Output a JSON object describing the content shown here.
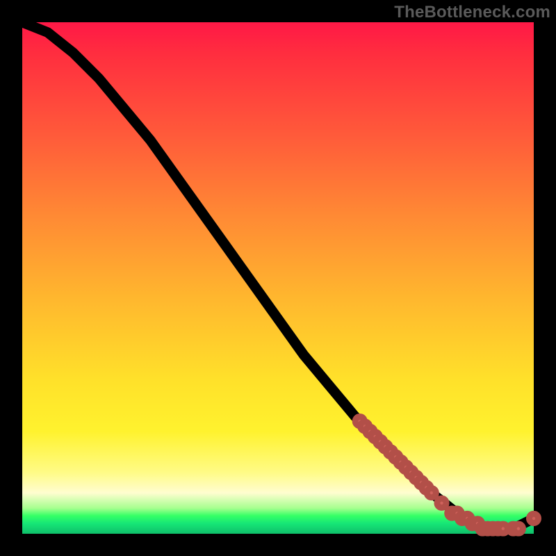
{
  "watermark": "TheBottleneck.com",
  "colors": {
    "marker_fill": "#cf625b",
    "marker_stroke": "#b24f48",
    "line": "#000000",
    "bg": "#000000"
  },
  "chart_data": {
    "type": "line",
    "title": "",
    "xlabel": "",
    "ylabel": "",
    "xlim": [
      0,
      100
    ],
    "ylim": [
      0,
      100
    ],
    "grid": false,
    "legend": false,
    "series": [
      {
        "name": "curve",
        "x": [
          0,
          5,
          10,
          15,
          20,
          25,
          30,
          35,
          40,
          45,
          50,
          55,
          60,
          65,
          70,
          75,
          80,
          85,
          88,
          92,
          96,
          100
        ],
        "y": [
          100,
          98,
          94,
          89,
          83,
          77,
          70,
          63,
          56,
          49,
          42,
          35,
          29,
          23,
          18,
          13,
          8,
          4,
          2,
          1,
          1,
          3
        ]
      }
    ],
    "markers": {
      "name": "highlight-points",
      "x": [
        66,
        67,
        68,
        69,
        70,
        71,
        72,
        73,
        74,
        75,
        76,
        77,
        78,
        79,
        80,
        82,
        84,
        85,
        86,
        87,
        88,
        89,
        90,
        91,
        92,
        93,
        94,
        96,
        97,
        100
      ],
      "y": [
        22,
        21,
        20,
        19,
        18,
        17,
        16,
        15,
        14,
        13,
        12,
        11,
        10,
        9,
        8,
        6,
        4,
        4,
        3,
        3,
        2,
        2,
        1,
        1,
        1,
        1,
        1,
        1,
        1,
        3
      ]
    }
  }
}
